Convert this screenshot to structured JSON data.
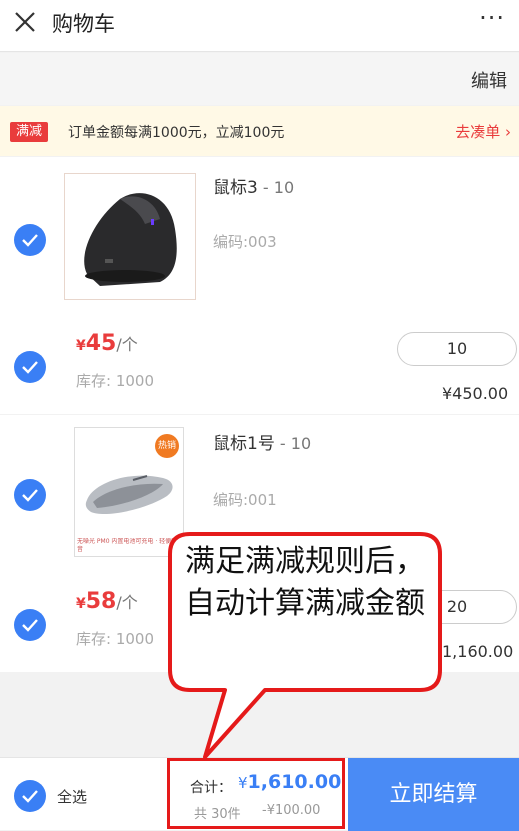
{
  "header": {
    "title": "购物车",
    "more_label": "···"
  },
  "editbar": {
    "edit_label": "编辑"
  },
  "promo": {
    "badge": "满减",
    "text": "订单金额每满1000元，立减100元",
    "link": "去凑单"
  },
  "products": [
    {
      "name": "鼠标3",
      "qty_suffix": " - 10",
      "code": "编码:003",
      "price_symbol": "¥",
      "price": "45",
      "unit": "/个",
      "stock": "库存: 1000",
      "quantity": "10",
      "subtotal": "¥450.00",
      "image_icon": "vertical-mouse-image"
    },
    {
      "name": "鼠标1号",
      "qty_suffix": " - 10",
      "code": "编码:001",
      "price_symbol": "¥",
      "price": "58",
      "unit": "/个",
      "stock": "库存: 1000",
      "quantity": "20",
      "subtotal": "1,160.00",
      "image_icon": "wireless-mouse-image",
      "image_badge": "热销",
      "image_caption": "无噪光 PM0  内置电池可充电 · 轻便静音"
    }
  ],
  "footer": {
    "select_all": "全选",
    "total_label": "合计：",
    "total_symbol": "¥",
    "total_amount": "1,610.00",
    "count": "共 30件",
    "discount": "-¥100.00",
    "checkout": "立即结算"
  },
  "callout": {
    "text": "满足满减规则后，自动计算满减金额"
  },
  "colors": {
    "accent": "#3a7ff5",
    "price_red": "#e93c3c",
    "checkout_bg": "#4a8bf5",
    "annotation_red": "#e51a1a"
  }
}
